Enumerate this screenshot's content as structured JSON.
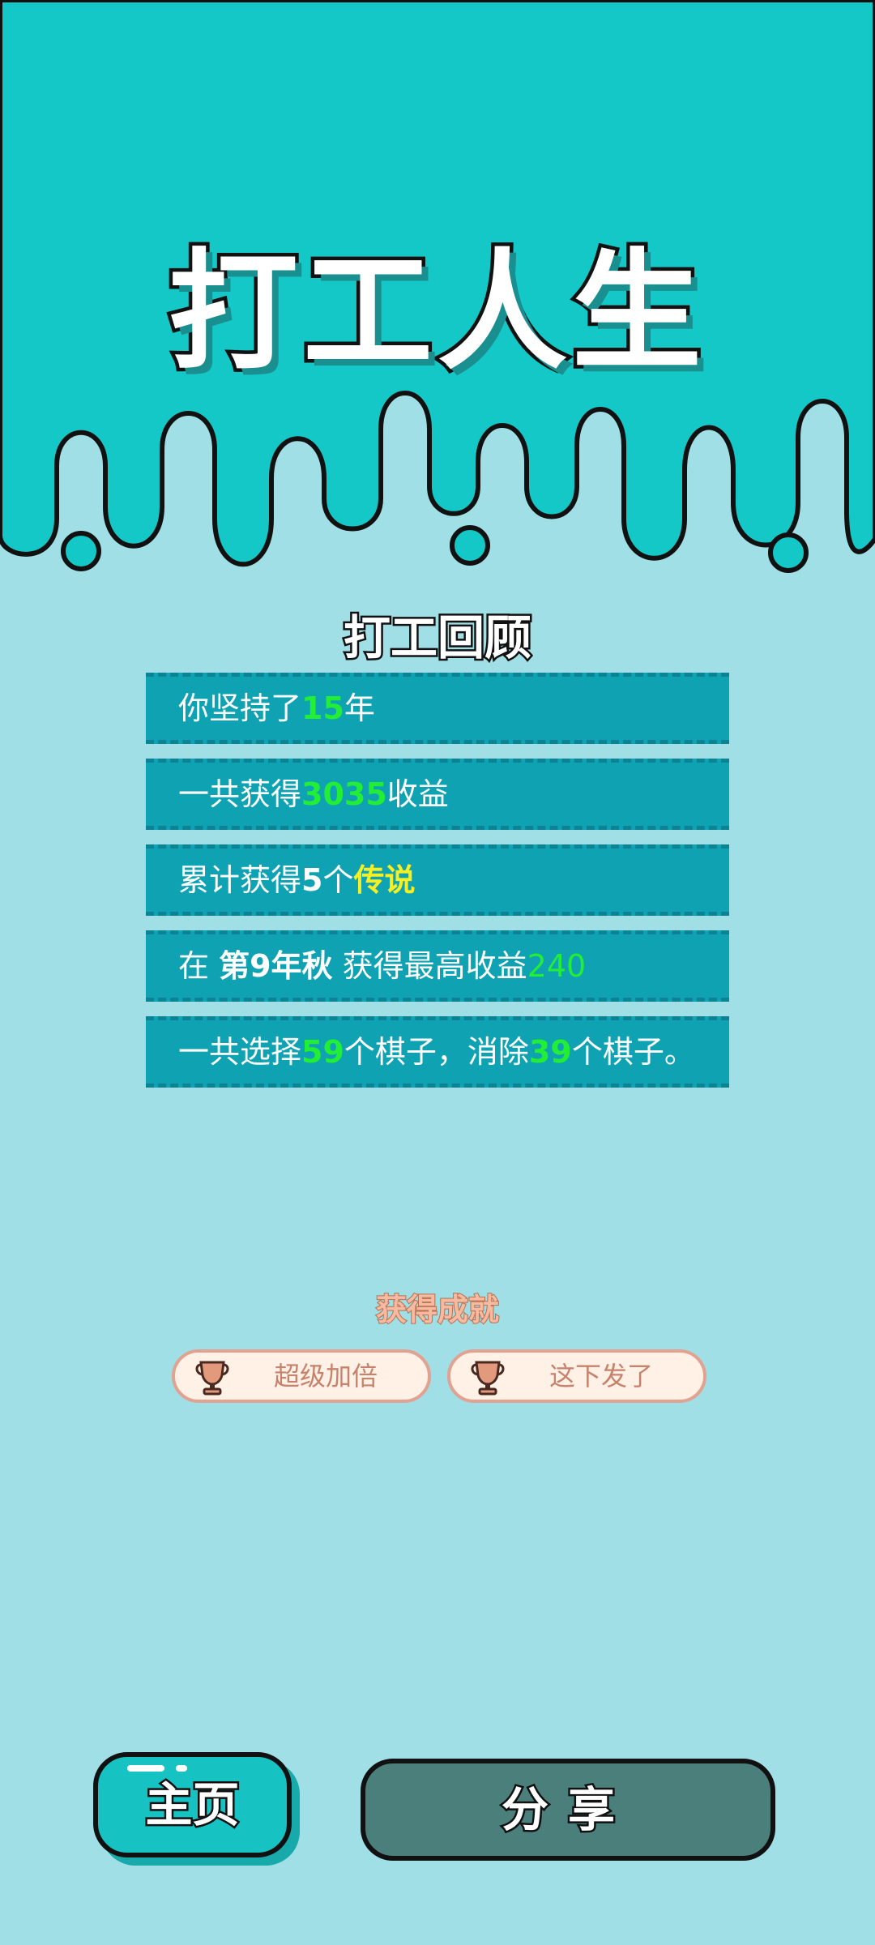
{
  "app": {
    "title": "打工人生"
  },
  "review": {
    "title": "打工回顾",
    "rows": [
      {
        "pre": "你坚持了",
        "value": "15",
        "post": "年"
      },
      {
        "pre": "一共获得",
        "value": "3035",
        "post": "收益"
      },
      {
        "pre": "累计获得",
        "count": "5",
        "mid": "个",
        "legend": "传说"
      },
      {
        "pre": "在 ",
        "season": "第9年秋",
        "mid": " 获得最高收益",
        "value": "240"
      },
      {
        "pre": "一共选择",
        "value1": "59",
        "mid": "个棋子，消除",
        "value2": "39",
        "post": "个棋子。"
      }
    ]
  },
  "achievements": {
    "title": "获得成就",
    "badges": [
      {
        "label": "超级加倍",
        "icon": "trophy-icon"
      },
      {
        "label": "这下发了",
        "icon": "trophy-icon"
      }
    ]
  },
  "buttons": {
    "home": "主页",
    "share": "分享"
  },
  "colors": {
    "top_teal": "#15c8c8",
    "page_bg": "#a1dfe6",
    "row_bg": "#0fa2b3",
    "highlight_green": "#22ee36",
    "highlight_yellow": "#f6ef23",
    "share_button": "#4a7f7b"
  }
}
